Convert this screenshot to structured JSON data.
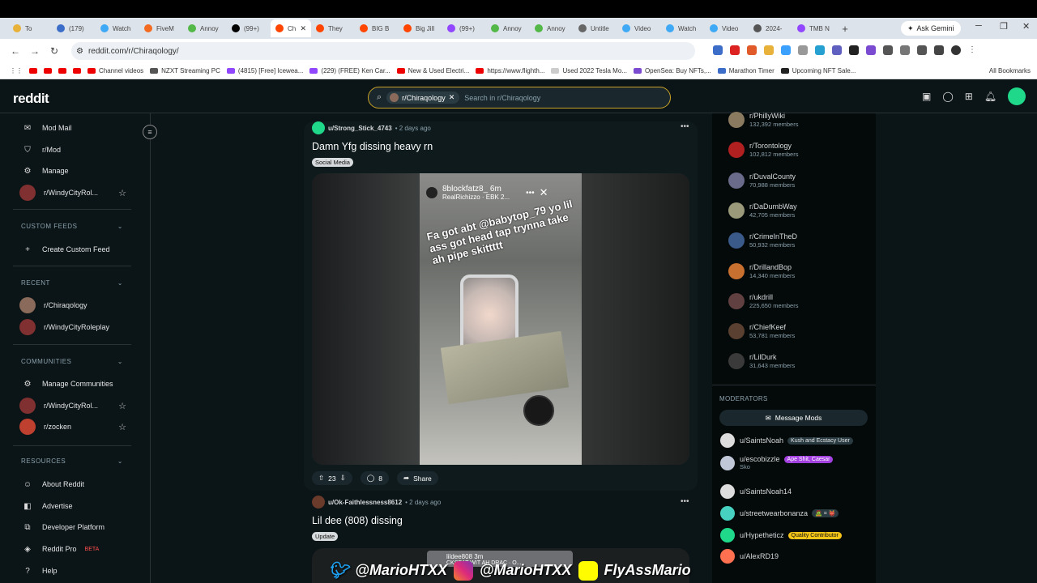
{
  "browser": {
    "tabs": [
      {
        "label": "To",
        "color": "#e8b13a"
      },
      {
        "label": "(179)",
        "color": "#3c6ec9"
      },
      {
        "label": "Watch",
        "color": "#3fa9f5"
      },
      {
        "label": "FiveM",
        "color": "#f26b21"
      },
      {
        "label": "Annoy",
        "color": "#53b848"
      },
      {
        "label": "(99+)",
        "color": "#000000"
      },
      {
        "label": "Ch",
        "color": "#ff4500"
      },
      {
        "label": "They",
        "color": "#ff4500"
      },
      {
        "label": "BIG B",
        "color": "#ff4500"
      },
      {
        "label": "Big Jill",
        "color": "#ff4500"
      },
      {
        "label": "(99+)",
        "color": "#9146ff"
      },
      {
        "label": "Annoy",
        "color": "#53b848"
      },
      {
        "label": "Annoy",
        "color": "#53b848"
      },
      {
        "label": "Untitle",
        "color": "#666666"
      },
      {
        "label": "Video",
        "color": "#3fa9f5"
      },
      {
        "label": "Watch",
        "color": "#3fa9f5"
      },
      {
        "label": "Video",
        "color": "#3fa9f5"
      },
      {
        "label": "2024-",
        "color": "#555555"
      },
      {
        "label": "TMB N",
        "color": "#9146ff"
      }
    ],
    "active_tab_index": 6,
    "ask_gemini": "Ask Gemini",
    "url": "reddit.com/r/Chiraqology/",
    "bookmarks": [
      "Channel videos",
      "NZXT Streaming PC",
      "(4815) [Free] Icewea...",
      "(229) (FREE) Ken Car...",
      "New & Used Electri...",
      "https://www.flighth...",
      "Used 2022 Tesla Mo...",
      "OpenSea: Buy NFTs,...",
      "Marathon Timer",
      "Upcoming NFT Sale..."
    ],
    "all_bookmarks": "All Bookmarks"
  },
  "header": {
    "logo": "reddit",
    "search_chip": "r/Chiraqology",
    "search_placeholder": "Search in r/Chiraqology"
  },
  "sidebar": {
    "top_items": [
      "Mod Mail",
      "r/Mod",
      "Manage",
      "r/WindyCityRol..."
    ],
    "custom_feeds_heading": "CUSTOM FEEDS",
    "create_custom_feed": "Create Custom Feed",
    "recent_heading": "RECENT",
    "recent": [
      "r/Chiraqology",
      "r/WindyCityRoleplay"
    ],
    "communities_heading": "COMMUNITIES",
    "manage_communities": "Manage Communities",
    "communities": [
      "r/WindyCityRol...",
      "r/zocken"
    ],
    "resources_heading": "RESOURCES",
    "resources": [
      "About Reddit",
      "Advertise",
      "Developer Platform",
      "Reddit Pro",
      "Help"
    ],
    "beta_label": "BETA"
  },
  "posts": [
    {
      "user": "u/Strong_Stick_4743",
      "time": "• 2 days ago",
      "title": "Damn Yfg dissing heavy rn",
      "flair": "Social Media",
      "story_user": "8blockfatz8_  6m",
      "story_sub": "RealRichizzo · EBK 2...",
      "story_text": "Fa got abt @babytop_79 yo lil ass got head tap trynna take ah pipe skittttt",
      "votes": "23",
      "comments": "8",
      "share": "Share"
    },
    {
      "user": "u/Ok-Faithlessness8612",
      "time": "• 2 days ago",
      "title": "Lil dee (808) dissing",
      "flair": "Update",
      "story_user": "lildee808  3m",
      "story_sub": "CKSEAT WIT AH DRAC · O..."
    }
  ],
  "related_communities": [
    {
      "name": "r/PhillyWiki",
      "members": "132,392 members",
      "color": "#8a7a60"
    },
    {
      "name": "r/Torontology",
      "members": "102,812 members",
      "color": "#b02020"
    },
    {
      "name": "r/DuvalCounty",
      "members": "70,988 members",
      "color": "#6a6a8a"
    },
    {
      "name": "r/DaDumbWay",
      "members": "42,705 members",
      "color": "#9a9a7a"
    },
    {
      "name": "r/CrimeInTheD",
      "members": "50,932 members",
      "color": "#3a5a8a"
    },
    {
      "name": "r/DrillandBop",
      "members": "14,340 members",
      "color": "#c87030"
    },
    {
      "name": "r/ukdrill",
      "members": "225,650 members",
      "color": "#604040"
    },
    {
      "name": "r/ChiefKeef",
      "members": "53,781 members",
      "color": "#5a4030"
    },
    {
      "name": "r/LilDurk",
      "members": "31,643 members",
      "color": "#3a3a3a"
    }
  ],
  "moderators_heading": "MODERATORS",
  "message_mods": "Message Mods",
  "moderators": [
    {
      "name": "u/SaintsNoah",
      "flair": "Kush and Ecstacy User",
      "flair_bg": "#2a3c42",
      "flair_fg": "#e4e6e7",
      "color": "#dddddd"
    },
    {
      "name": "u/escobizzle",
      "flair": "Ape Shit, Caesar",
      "flair_bg": "#a340e0",
      "flair_fg": "#ffffff",
      "color": "#c0c8d8",
      "sub": "Sko"
    },
    {
      "name": "u/SaintsNoah14",
      "flair": "",
      "color": "#dddddd"
    },
    {
      "name": "u/streetwearbonanza",
      "flair": "🧟 = 👹",
      "flair_bg": "#2a3c42",
      "flair_fg": "#e4e6e7",
      "color": "#46d1c0"
    },
    {
      "name": "u/Hypetheticz",
      "flair": "Quality Contributor",
      "flair_bg": "#f5c518",
      "flair_fg": "#111111",
      "color": "#1fd88a"
    },
    {
      "name": "u/AlexRD19",
      "flair": "",
      "color": "#ff7050"
    }
  ],
  "overlay": {
    "twitter": "@MarioHTXX",
    "instagram": "@MarioHTXX",
    "snapchat": "FlyAssMario"
  }
}
